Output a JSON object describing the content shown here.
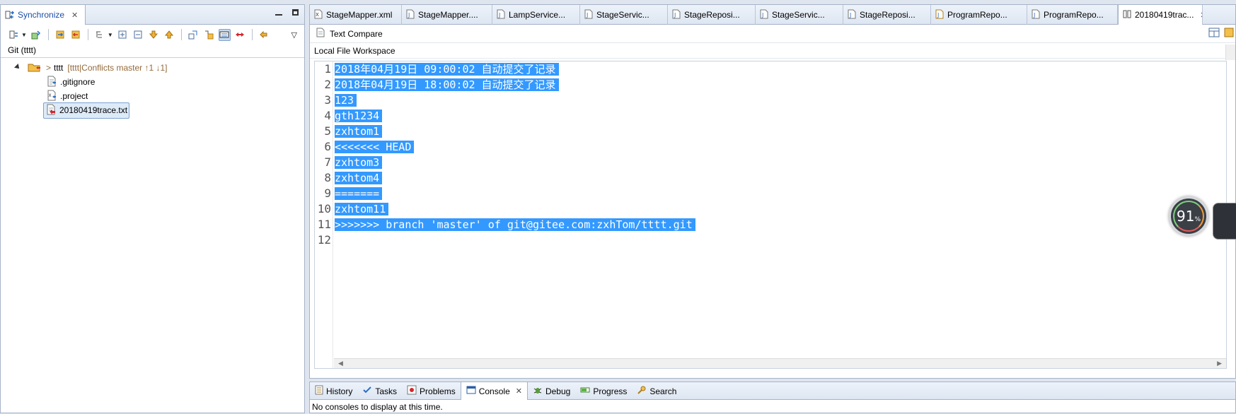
{
  "left_view": {
    "tab_label": "Synchronize",
    "title": "Git (tttt)",
    "tree": {
      "project": "tttt",
      "project_prefix": ">",
      "status": "[tttt|Conflicts master ↑1 ↓1]",
      "files": [
        ".gitignore",
        ".project",
        "20180419trace.txt"
      ]
    }
  },
  "editor": {
    "tabs": [
      "StageMapper.xml",
      "StageMapper....",
      "LampService...",
      "StageServic...",
      "StageReposi...",
      "StageServic...",
      "StageReposi...",
      "ProgramRepo...",
      "ProgramRepo...",
      "20180419trac..."
    ],
    "compare_title": "Text Compare",
    "pane_title": "Local File Workspace",
    "line_numbers": [
      "1",
      "2",
      "3",
      "4",
      "5",
      "6",
      "7",
      "8",
      "9",
      "10",
      "11",
      "12"
    ],
    "lines": [
      "2018年04月19日 09:00:02 自动提交了记录",
      "2018年04月19日 18:00:02 自动提交了记录",
      "123",
      "gth1234",
      "zxhtom1",
      "<<<<<<< HEAD",
      "zxhtom3",
      "zxhtom4",
      "=======",
      "zxhtom11",
      ">>>>>>> branch 'master' of git@gitee.com:zxhTom/tttt.git",
      ""
    ]
  },
  "bottom": {
    "tabs": [
      "History",
      "Tasks",
      "Problems",
      "Console",
      "Debug",
      "Progress",
      "Search"
    ],
    "console_message": "No consoles to display at this time."
  },
  "widget": {
    "percent": "91",
    "unit": "%"
  },
  "colors": {
    "selection": "#3399ff",
    "conflict_text": "#946a3a",
    "active_tab_text": "#1a4ea8"
  }
}
